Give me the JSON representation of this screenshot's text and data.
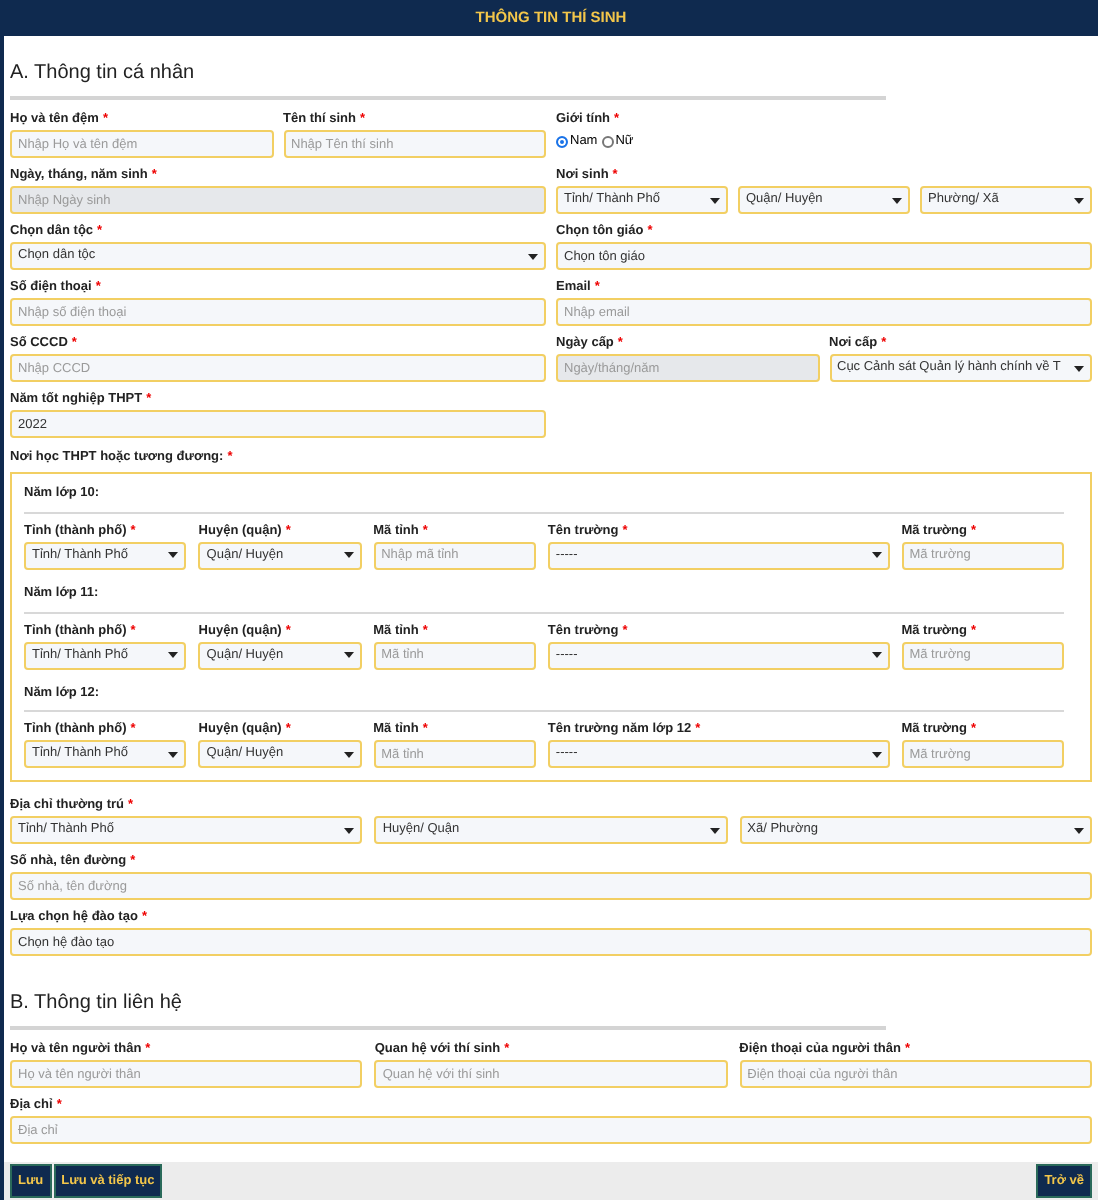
{
  "header": {
    "title": "THÔNG TIN THÍ SINH"
  },
  "section_a": {
    "heading": "A. Thông tin cá nhân",
    "middle_name": {
      "label": "Họ và tên đệm",
      "mark": "*",
      "kind": "text",
      "placeholder": "Nhập Họ và tên đệm"
    },
    "first_name": {
      "label": "Tên thí sinh",
      "mark": "*",
      "kind": "text",
      "placeholder": "Nhập Tên thí sinh"
    },
    "gender": {
      "label": "Giới tính",
      "mark": "*",
      "options": [
        {
          "label": "Nam",
          "selected": true
        },
        {
          "label": "Nữ",
          "selected": false
        }
      ]
    },
    "birth_date": {
      "label": "Ngày, tháng, năm sinh",
      "mark": "*",
      "kind": "text",
      "placeholder": "Nhập Ngày sinh",
      "disabled": true
    },
    "birthplace": {
      "label": "Nơi sinh",
      "mark": "*",
      "selects": [
        "Tỉnh/ Thành Phố",
        "Quận/ Huyện",
        "Phường/ Xã"
      ]
    },
    "ethnicity": {
      "label": "Chọn dân tộc",
      "mark": "*",
      "kind": "select",
      "value": "Chọn dân tộc"
    },
    "religion": {
      "label": "Chọn tôn giáo",
      "mark": "*",
      "kind": "text",
      "value": "Chọn tôn giáo"
    },
    "phone": {
      "label": "Số điện thoại",
      "mark": "*",
      "kind": "text",
      "placeholder": "Nhập số điện thoại"
    },
    "email": {
      "label": "Email",
      "mark": "*",
      "kind": "text",
      "placeholder": "Nhập email"
    },
    "id_number": {
      "label": "Số CCCD",
      "mark": "*",
      "kind": "text",
      "placeholder": "Nhập CCCD"
    },
    "issue_date": {
      "label": "Ngày cấp",
      "mark": "*",
      "kind": "text",
      "placeholder": "Ngày/tháng/năm",
      "disabled": true
    },
    "issue_place": {
      "label": "Nơi cấp",
      "mark": "*",
      "kind": "select",
      "value": "Cục Cảnh sát Quản lý hành chính về T"
    },
    "graduation_year": {
      "label": "Năm tốt nghiệp THPT",
      "mark": "*",
      "kind": "text",
      "value": "2022"
    },
    "school": {
      "label": "Nơi học THPT hoặc tương đương:",
      "mark": "*",
      "years": [
        {
          "title": "Năm lớp 10:",
          "fields": [
            {
              "label": "Tỉnh (thành phố)",
              "mark": "*",
              "kind": "select",
              "value": "Tỉnh/ Thành Phố"
            },
            {
              "label": "Huyện (quận)",
              "mark": "*",
              "kind": "select",
              "value": "Quận/ Huyện"
            },
            {
              "label": "Mã tỉnh",
              "mark": "*",
              "kind": "text",
              "placeholder": "Nhập mã tỉnh"
            },
            {
              "label": "Tên trường",
              "mark": "*",
              "kind": "select",
              "value": "-----"
            },
            {
              "label": "Mã trường",
              "mark": "*",
              "kind": "text",
              "placeholder": "Mã trường"
            }
          ]
        },
        {
          "title": "Năm lớp 11:",
          "fields": [
            {
              "label": "Tỉnh (thành phố)",
              "mark": "*",
              "kind": "select",
              "value": "Tỉnh/ Thành Phố"
            },
            {
              "label": "Huyện (quận)",
              "mark": "*",
              "kind": "select",
              "value": "Quận/ Huyện"
            },
            {
              "label": "Mã tỉnh",
              "mark": "*",
              "kind": "text",
              "placeholder": "Mã tỉnh"
            },
            {
              "label": "Tên trường",
              "mark": "*",
              "kind": "select",
              "value": "-----"
            },
            {
              "label": "Mã trường",
              "mark": "*",
              "kind": "text",
              "placeholder": "Mã trường"
            }
          ]
        },
        {
          "title": "Năm lớp 12:",
          "fields": [
            {
              "label": "Tỉnh (thành phố)",
              "mark": "*",
              "kind": "select",
              "value": "Tỉnh/ Thành Phố"
            },
            {
              "label": "Huyện (quận)",
              "mark": "*",
              "kind": "select",
              "value": "Quận/ Huyện"
            },
            {
              "label": "Mã tỉnh",
              "mark": "*",
              "kind": "text",
              "placeholder": "Mã tỉnh"
            },
            {
              "label": "Tên trường năm lớp 12",
              "mark": "*",
              "kind": "select",
              "value": "-----"
            },
            {
              "label": "Mã trường",
              "mark": "*",
              "kind": "text",
              "placeholder": "Mã trường"
            }
          ]
        }
      ]
    },
    "residence": {
      "label": "Địa chỉ thường trú",
      "mark": "*",
      "selects": [
        "Tỉnh/ Thành Phố",
        "Huyện/ Quận",
        "Xã/ Phường"
      ]
    },
    "street": {
      "label": "Số nhà, tên đường",
      "mark": "*",
      "kind": "text",
      "placeholder": "Số nhà, tên đường"
    },
    "training": {
      "label": "Lựa chọn hệ đào tạo",
      "mark": "*",
      "kind": "text",
      "value": "Chọn hệ đào tạo"
    }
  },
  "section_b": {
    "heading": "B. Thông tin liên hệ",
    "relative_name": {
      "label": "Họ và tên người thân",
      "mark": "*",
      "kind": "text",
      "placeholder": "Họ và tên người thân"
    },
    "relationship": {
      "label": "Quan hệ với thí sinh",
      "mark": "*",
      "kind": "text",
      "placeholder": "Quan hệ với thí sinh"
    },
    "relative_phone": {
      "label": "Điện thoại của người thân",
      "mark": "*",
      "kind": "text",
      "placeholder": "Điện thoại của người thân"
    },
    "address": {
      "label": "Địa chỉ",
      "mark": "*",
      "kind": "text",
      "placeholder": "Địa chỉ"
    }
  },
  "actions": {
    "left": [
      "Lưu",
      "Lưu và tiếp tục"
    ],
    "right": [
      "Trở về"
    ]
  }
}
